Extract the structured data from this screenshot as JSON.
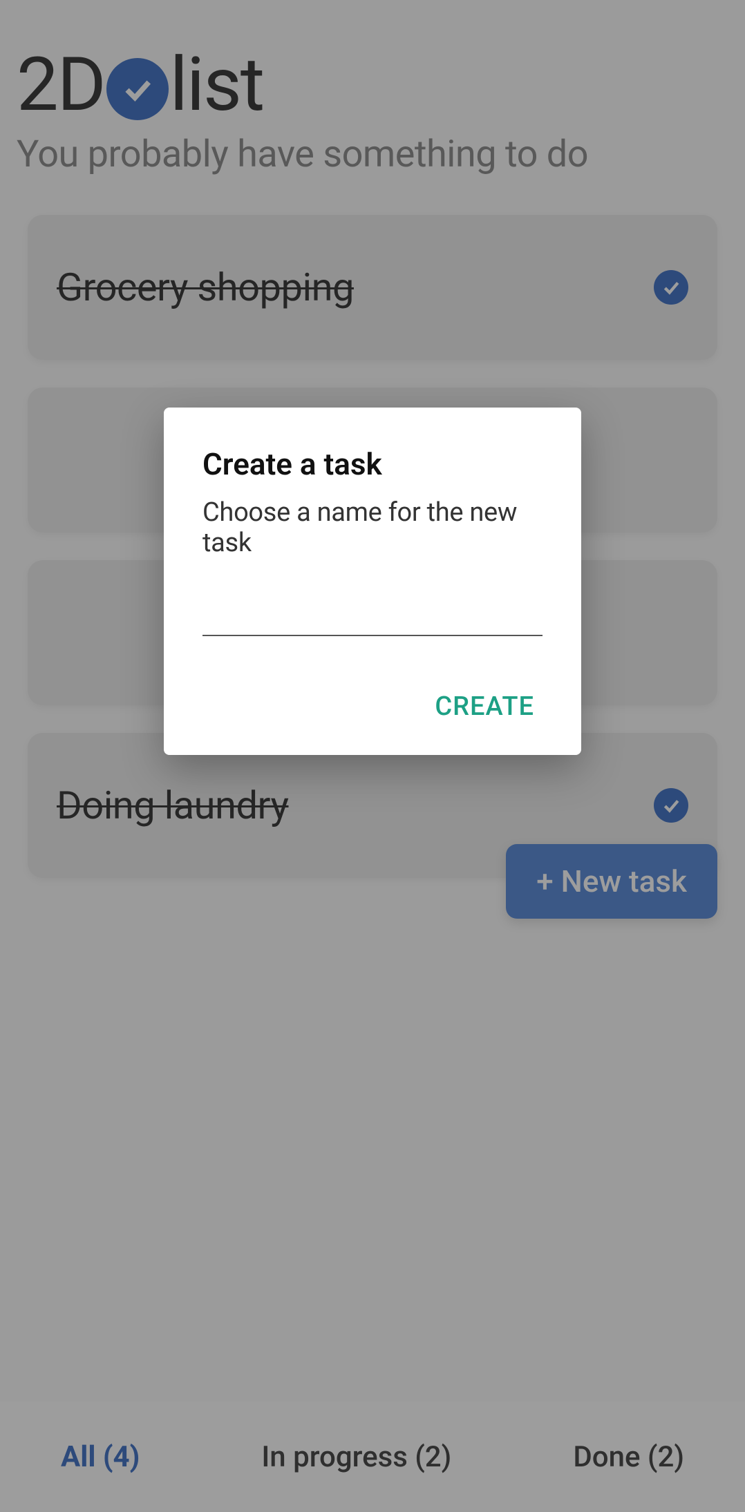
{
  "header": {
    "logo_part1": "2D",
    "logo_part2": "list",
    "tagline": "You probably have something to do"
  },
  "tasks": [
    {
      "title": "Grocery shopping",
      "done": true
    },
    {
      "title": "",
      "done": false
    },
    {
      "title": "",
      "done": false
    },
    {
      "title": "Doing laundry",
      "done": true
    }
  ],
  "fab": {
    "label": "+ New task"
  },
  "tabs": {
    "all": "All (4)",
    "in_progress": "In progress (2)",
    "done": "Done (2)"
  },
  "dialog": {
    "title": "Create a task",
    "subtitle": "Choose a name for the new task",
    "input_value": "",
    "action_create": "CREATE"
  },
  "colors": {
    "accent": "#1e58ba",
    "fab": "#3a75d0",
    "dialog_action": "#1da085"
  }
}
